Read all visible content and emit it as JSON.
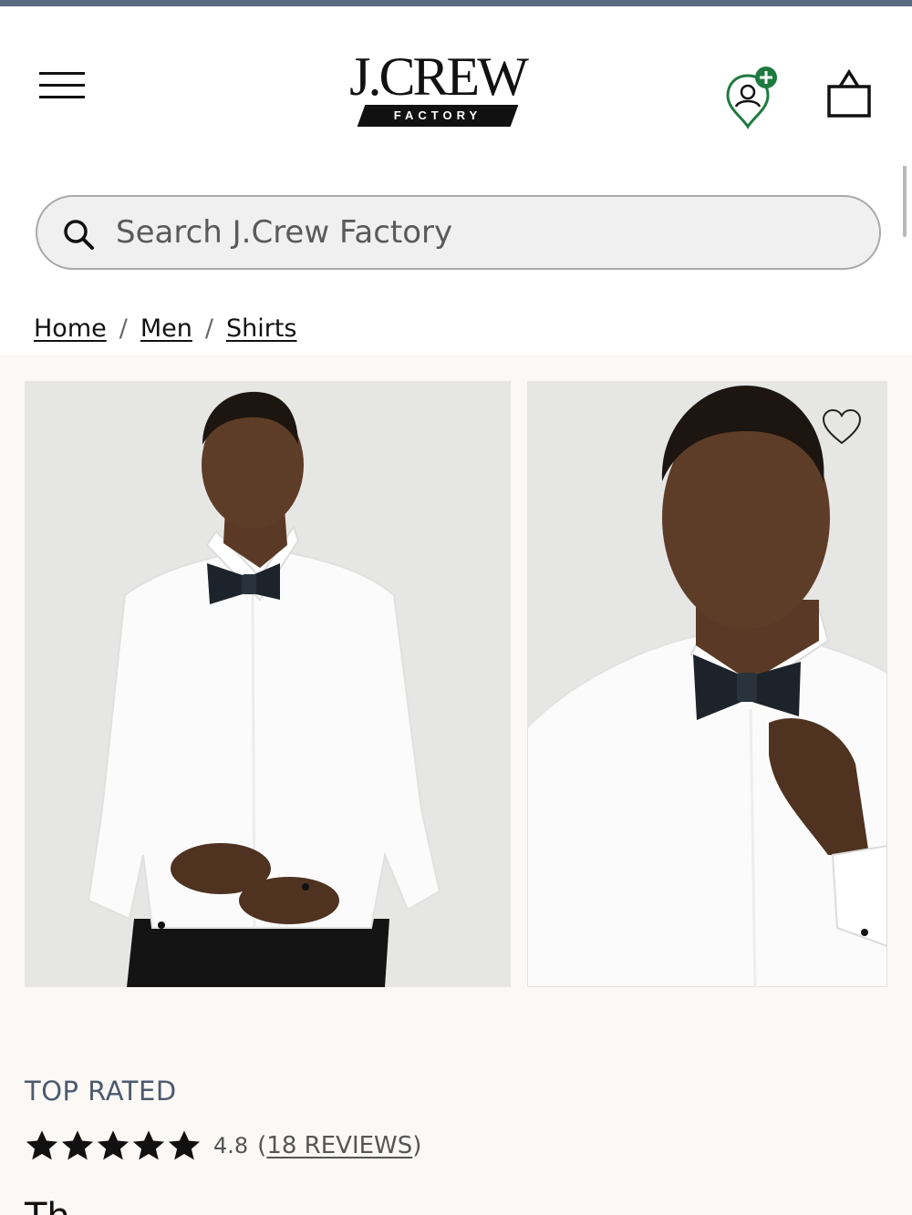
{
  "header": {
    "logo_text": "J.CREW",
    "logo_subtext": "FACTORY",
    "menu_icon": "hamburger-menu-icon",
    "account_icon": "account-pin-plus-icon",
    "bag_icon": "shopping-bag-icon"
  },
  "search": {
    "placeholder": "Search J.Crew Factory",
    "icon": "search-icon"
  },
  "breadcrumb": {
    "items": [
      "Home",
      "Men",
      "Shirts"
    ],
    "separator": "/"
  },
  "product": {
    "badge": "TOP RATED",
    "rating": "4.8",
    "stars": 5,
    "reviews_prefix": "(",
    "reviews_label": "18 REVIEWS",
    "reviews_suffix": ")",
    "description_peek": "Th",
    "images": [
      "model-front-tuxedo-shirt",
      "model-closeup-bow-tie"
    ]
  },
  "colors": {
    "top_bar": "#5b6b80",
    "account_accent": "#1f7a3f",
    "badge_text": "#4c5a6d",
    "page_bg": "#fbf8f6"
  }
}
